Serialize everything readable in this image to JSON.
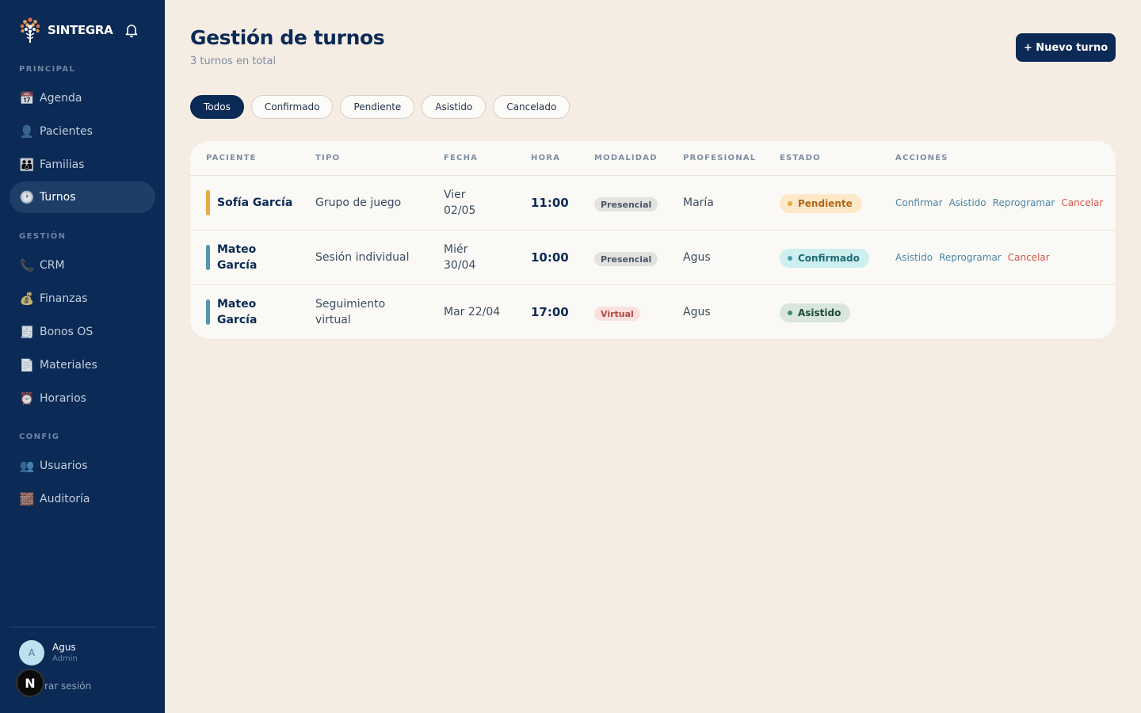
{
  "app": {
    "brand": "SINTEGRA",
    "user": {
      "name": "Agus",
      "role": "Admin",
      "initial": "A"
    },
    "logout": "rar sesión",
    "badge_letter": "N"
  },
  "sidebar": {
    "sections": [
      {
        "label": "PRINCIPAL",
        "items": [
          {
            "label": "Agenda",
            "icon": "calendar-icon",
            "glyph": "📅"
          },
          {
            "label": "Pacientes",
            "icon": "person-icon",
            "glyph": "👤"
          },
          {
            "label": "Familias",
            "icon": "family-icon",
            "glyph": "👪"
          },
          {
            "label": "Turnos",
            "icon": "clock-icon",
            "glyph": "🕐",
            "active": true
          }
        ]
      },
      {
        "label": "GESTIÓN",
        "items": [
          {
            "label": "CRM",
            "icon": "phone-icon",
            "glyph": "📞"
          },
          {
            "label": "Finanzas",
            "icon": "money-bag-icon",
            "glyph": "💰"
          },
          {
            "label": "Bonos OS",
            "icon": "receipt-icon",
            "glyph": "🧾"
          },
          {
            "label": "Materiales",
            "icon": "document-icon",
            "glyph": "📄"
          },
          {
            "label": "Horarios",
            "icon": "alarm-clock-icon",
            "glyph": "⏰"
          }
        ]
      },
      {
        "label": "CONFIG",
        "items": [
          {
            "label": "Usuarios",
            "icon": "users-icon",
            "glyph": "👥"
          },
          {
            "label": "Auditoría",
            "icon": "bricks-icon",
            "glyph": "🧱"
          }
        ]
      }
    ]
  },
  "header": {
    "title": "Gestión de turnos",
    "subtitle": "3 turnos en total",
    "new_button": "+ Nuevo turno"
  },
  "filters": [
    {
      "label": "Todos",
      "active": true
    },
    {
      "label": "Confirmado"
    },
    {
      "label": "Pendiente"
    },
    {
      "label": "Asistido"
    },
    {
      "label": "Cancelado"
    }
  ],
  "table": {
    "columns": [
      "PACIENTE",
      "TIPO",
      "FECHA",
      "HORA",
      "MODALIDAD",
      "PROFESIONAL",
      "ESTADO",
      "ACCIONES"
    ],
    "rows": [
      {
        "paciente": [
          "Sofía García"
        ],
        "tipo": [
          "Grupo de juego"
        ],
        "fecha": [
          "Vier",
          "02/05"
        ],
        "hora": "11:00",
        "modalidad": "Presencial",
        "profesional": "María",
        "estado": "Pendiente",
        "acciones": [
          {
            "label": "Confirmar"
          },
          {
            "label": "Asistido"
          },
          {
            "label": "Reprogramar"
          },
          {
            "label": "Cancelar",
            "danger": true
          }
        ]
      },
      {
        "paciente": [
          "Mateo",
          "García"
        ],
        "tipo": [
          "Sesión individual"
        ],
        "fecha": [
          "Miér",
          "30/04"
        ],
        "hora": "10:00",
        "modalidad": "Presencial",
        "profesional": "Agus",
        "estado": "Confirmado",
        "acciones": [
          {
            "label": "Asistido"
          },
          {
            "label": "Reprogramar"
          },
          {
            "label": "Cancelar",
            "danger": true
          }
        ]
      },
      {
        "paciente": [
          "Mateo",
          "García"
        ],
        "tipo": [
          "Seguimiento",
          "virtual"
        ],
        "fecha": [
          "Mar 22/04"
        ],
        "hora": "17:00",
        "modalidad": "Virtual",
        "profesional": "Agus",
        "estado": "Asistido",
        "acciones": []
      }
    ]
  },
  "colors": {
    "sidebar_bg": "#0b2a55",
    "page_bg": "#f5ede4",
    "pendiente": "#e8a940",
    "confirmado": "#4f98ab",
    "asistido": "#3f8a72",
    "cancelar": "#d0574a"
  }
}
